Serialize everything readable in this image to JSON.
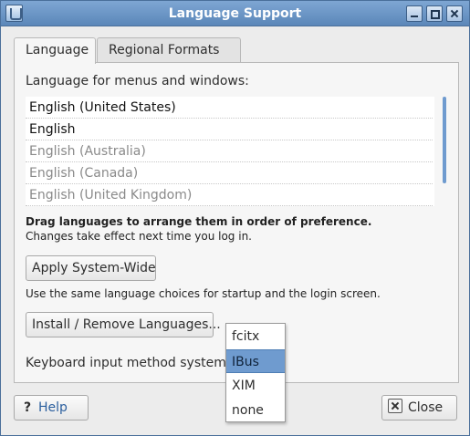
{
  "window": {
    "title": "Language Support"
  },
  "tabs": [
    {
      "label": "Language"
    },
    {
      "label": "Regional Formats"
    }
  ],
  "language": {
    "menus_label": "Language for menus and windows:",
    "items": [
      {
        "label": "English (United States)"
      },
      {
        "label": "English"
      },
      {
        "label": "English (Australia)"
      },
      {
        "label": "English (Canada)"
      },
      {
        "label": "English (United Kingdom)"
      }
    ],
    "drag_hint": "Drag languages to arrange them in order of preference.",
    "changes_hint": "Changes take effect next time you log in.",
    "apply_label": "Apply System-Wide",
    "startup_hint": "Use the same language choices for startup and the login screen.",
    "install_label": "Install / Remove Languages...",
    "keyboard_label": "Keyboard input method system:"
  },
  "input_method": {
    "options": [
      "fcitx",
      "IBus",
      "XIM",
      "none"
    ],
    "selected": "IBus"
  },
  "footer": {
    "help_label": "Help",
    "close_label": "Close"
  },
  "colors": {
    "titlebar": "#5b87b9",
    "selection": "#6f9bcf",
    "link": "#2b5f9e"
  }
}
